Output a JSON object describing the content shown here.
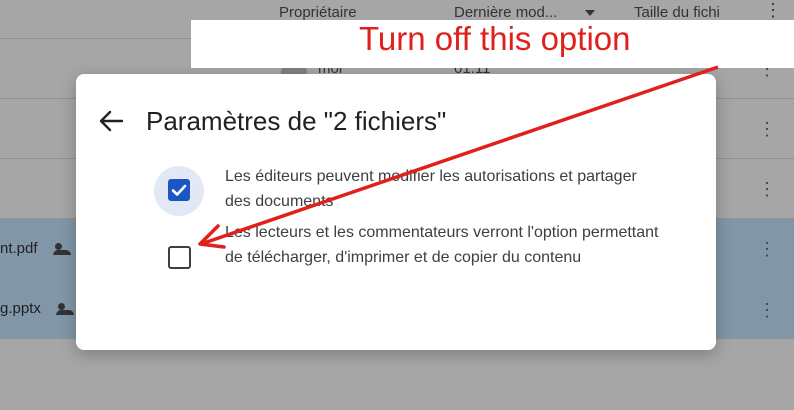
{
  "list": {
    "header": {
      "owner": "Propriétaire",
      "modified": "Dernière mod...",
      "size": "Taille du fichi"
    },
    "rows": [
      {
        "owner": "moi",
        "modified": "01:11",
        "size": "—"
      },
      {
        "name": "nt.pdf"
      },
      {
        "name": "g.pptx"
      }
    ]
  },
  "dialog": {
    "title": "Paramètres de \"2 fichiers\"",
    "options": [
      {
        "label": "Les éditeurs peuvent modifier les autorisations et partager des documents",
        "checked": true
      },
      {
        "label": "Les lecteurs et les commentateurs verront l'option permettant de télécharger, d'imprimer et de copier du contenu",
        "checked": false
      }
    ]
  },
  "annotation": {
    "text": "Turn off this option",
    "color": "#e0201c"
  },
  "colors": {
    "accent": "#1a56c4",
    "selected_row": "#c2e7ff"
  }
}
